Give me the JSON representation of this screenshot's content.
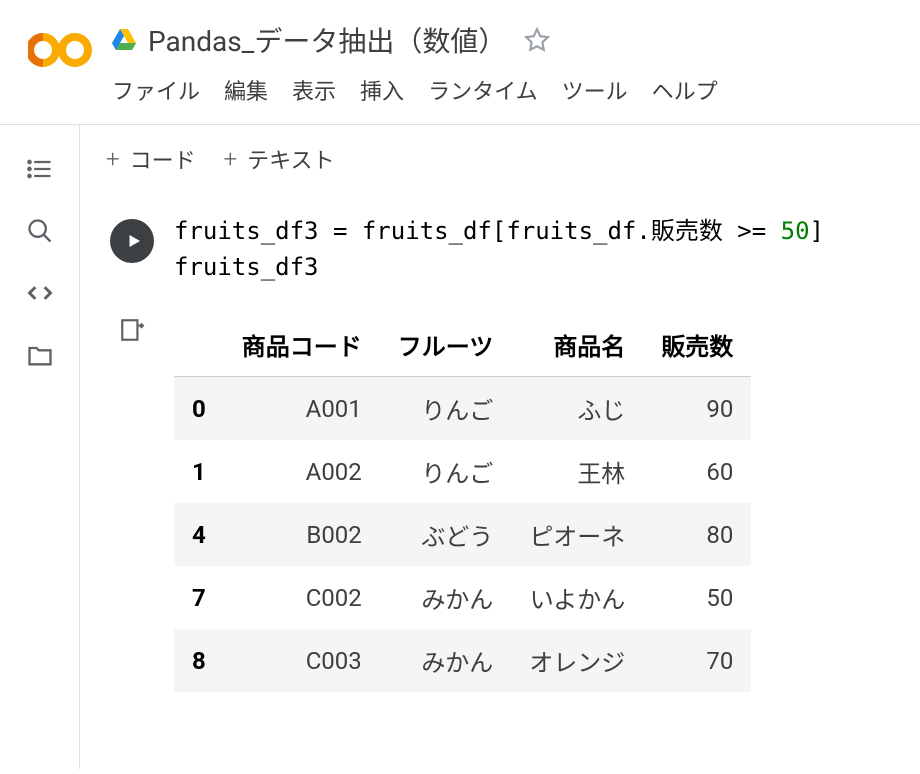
{
  "header": {
    "title": "Pandas_データ抽出（数値）"
  },
  "menu": {
    "file": "ファイル",
    "edit": "編集",
    "view": "表示",
    "insert": "挿入",
    "runtime": "ランタイム",
    "tools": "ツール",
    "help": "ヘルプ"
  },
  "toolbar": {
    "code": "コード",
    "text": "テキスト"
  },
  "cell": {
    "code_line1_pre": "fruits_df3 = fruits_df[fruits_df.販売数 >= ",
    "code_line1_num": "50",
    "code_line1_post": "]",
    "code_line2": "fruits_df3"
  },
  "output": {
    "columns": [
      "商品コード",
      "フルーツ",
      "商品名",
      "販売数"
    ],
    "rows": [
      {
        "index": "0",
        "code": "A001",
        "fruit": "りんご",
        "name": "ふじ",
        "sales": "90"
      },
      {
        "index": "1",
        "code": "A002",
        "fruit": "りんご",
        "name": "王林",
        "sales": "60"
      },
      {
        "index": "4",
        "code": "B002",
        "fruit": "ぶどう",
        "name": "ピオーネ",
        "sales": "80"
      },
      {
        "index": "7",
        "code": "C002",
        "fruit": "みかん",
        "name": "いよかん",
        "sales": "50"
      },
      {
        "index": "8",
        "code": "C003",
        "fruit": "みかん",
        "name": "オレンジ",
        "sales": "70"
      }
    ]
  }
}
